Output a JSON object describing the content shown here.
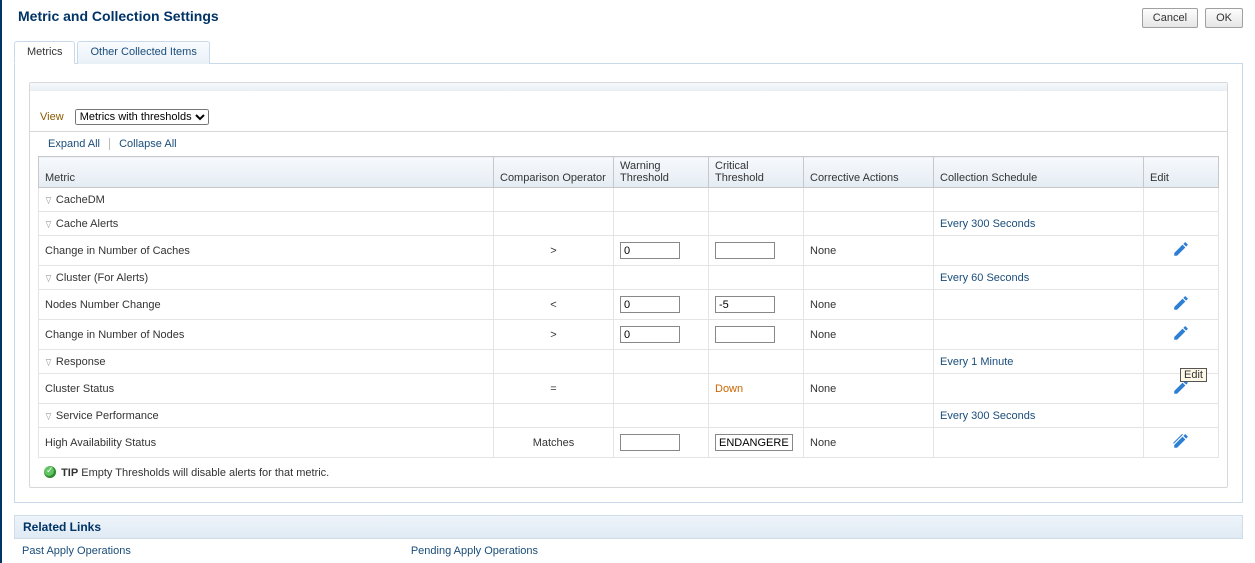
{
  "page": {
    "title": "Metric and Collection Settings"
  },
  "buttons": {
    "cancel": "Cancel",
    "ok": "OK"
  },
  "tabs": {
    "metrics": "Metrics",
    "other": "Other Collected Items"
  },
  "view": {
    "label": "View",
    "selected": "Metrics with thresholds"
  },
  "actions": {
    "expand_all": "Expand All",
    "collapse_all": "Collapse All"
  },
  "columns": {
    "metric": "Metric",
    "comparison": "Comparison Operator",
    "warning": "Warning Threshold",
    "critical": "Critical Threshold",
    "corrective": "Corrective Actions",
    "schedule": "Collection Schedule",
    "edit": "Edit"
  },
  "rows": {
    "cacheDM": "CacheDM",
    "cacheAlerts": {
      "label": "Cache Alerts",
      "schedule": "Every 300 Seconds"
    },
    "changeCaches": {
      "label": "Change in Number of Caches",
      "op": ">",
      "warn": "0",
      "crit": "",
      "corr": "None"
    },
    "clusterAlerts": {
      "label": "Cluster (For Alerts)",
      "schedule": "Every 60 Seconds"
    },
    "nodesChange": {
      "label": "Nodes Number Change",
      "op": "<",
      "warn": "0",
      "crit": "-5",
      "corr": "None"
    },
    "changeNodes": {
      "label": "Change in Number of Nodes",
      "op": ">",
      "warn": "0",
      "crit": "",
      "corr": "None"
    },
    "response": {
      "label": "Response",
      "schedule": "Every 1 Minute"
    },
    "clusterStatus": {
      "label": "Cluster Status",
      "op": "=",
      "crit_text": "Down",
      "corr": "None"
    },
    "servicePerf": {
      "label": "Service Performance",
      "schedule": "Every 300 Seconds"
    },
    "haStatus": {
      "label": "High Availability Status",
      "op": "Matches",
      "warn": "",
      "crit": "ENDANGERED",
      "corr": "None"
    }
  },
  "tip": {
    "label": "TIP",
    "text": " Empty Thresholds will disable alerts for that metric."
  },
  "related": {
    "title": "Related Links",
    "past": "Past Apply Operations",
    "pending": "Pending Apply Operations"
  },
  "tooltip": "Edit"
}
